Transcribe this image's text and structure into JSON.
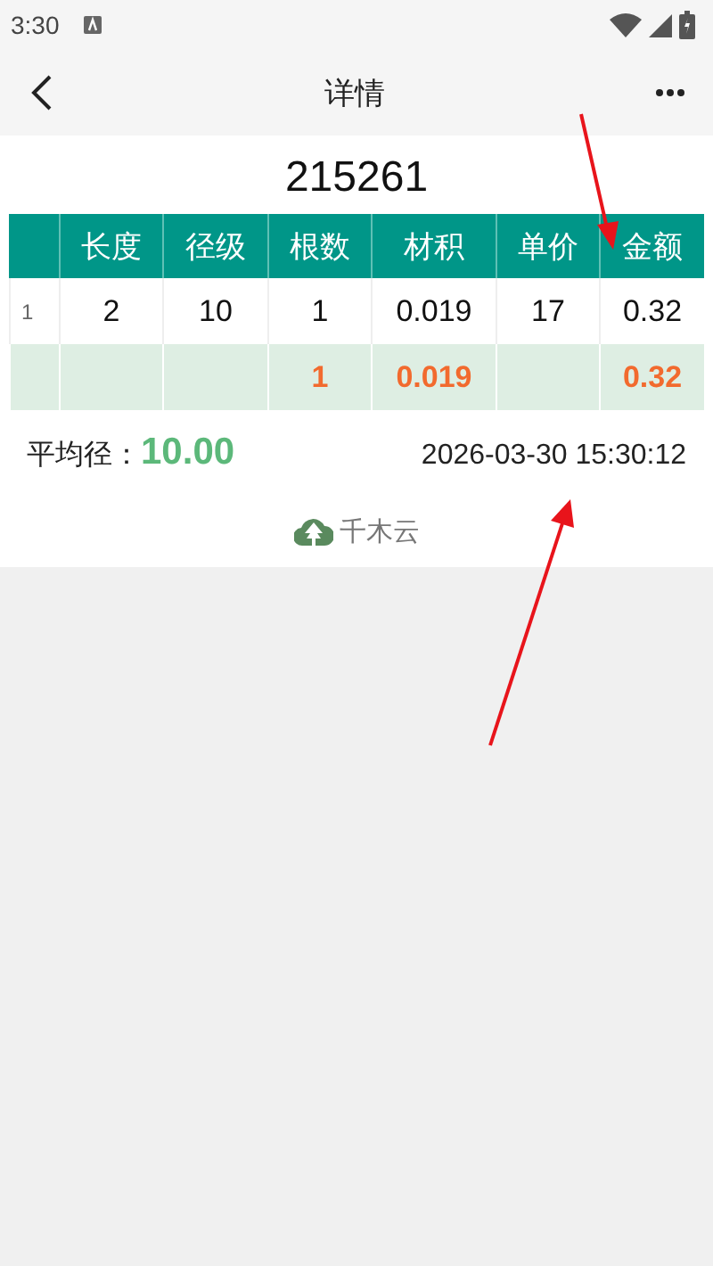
{
  "status_bar": {
    "time": "3:30"
  },
  "nav": {
    "title": "详情"
  },
  "record": {
    "number": "215261"
  },
  "table": {
    "columns": [
      "",
      "长度",
      "径级",
      "根数",
      "材积",
      "单价",
      "金额"
    ],
    "rows": [
      {
        "kind": "item",
        "cells": [
          "1",
          "2",
          "10",
          "1",
          "0.019",
          "17",
          "0.32"
        ]
      },
      {
        "kind": "total",
        "cells": [
          null,
          null,
          null,
          "1",
          "0.019",
          null,
          "0.32"
        ]
      }
    ]
  },
  "summary": {
    "label": "平均径：",
    "value": "10.00",
    "datetime": "2026-03-30 15:30:12"
  },
  "brand": {
    "name": "千木云"
  }
}
